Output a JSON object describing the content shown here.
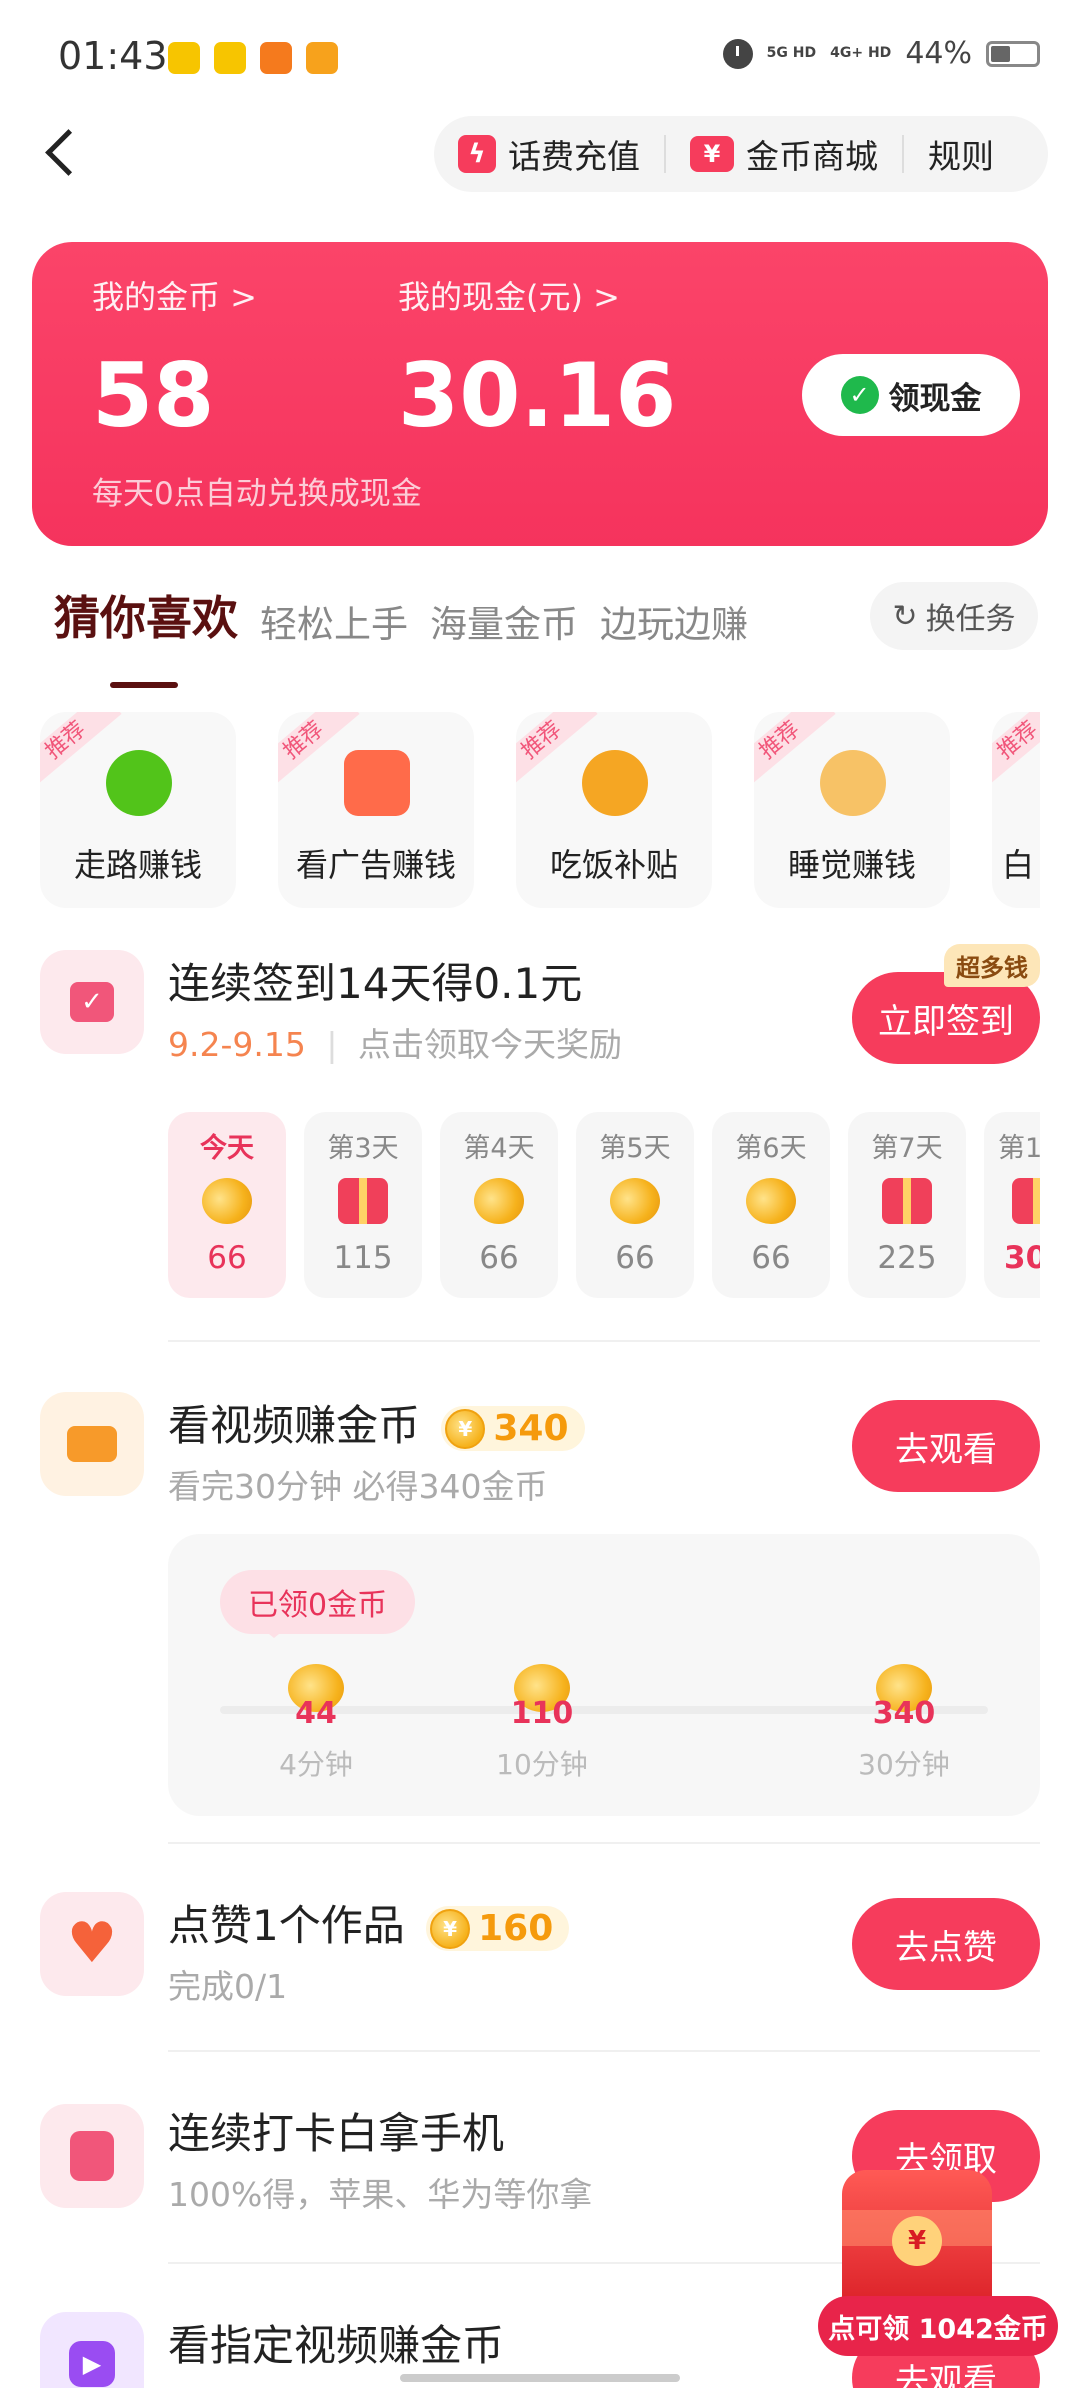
{
  "status_bar": {
    "time": "01:43",
    "signal1": "5G HD",
    "signal2": "4G+ HD",
    "battery": "44%",
    "battery_level": 0.44,
    "app_colors": [
      "#f7c500",
      "#f7c500",
      "#f57a1d",
      "#f7a21c"
    ]
  },
  "header": {
    "recharge_label": "话费充值",
    "mall_label": "金币商城",
    "rules_label": "规则",
    "mall_icon_glyph": "¥",
    "recharge_icon_glyph": "ϟ"
  },
  "balance": {
    "coins_label": "我的金币 >",
    "coins_value": "58",
    "cash_label": "我的现金(元) >",
    "cash_value": "30.16",
    "claim_cash_label": "领现金",
    "note": "每天0点自动兑换成现金",
    "card_color": "#f5335d"
  },
  "tabs": {
    "items": [
      "猜你喜欢",
      "轻松上手",
      "海量金币",
      "边玩边赚"
    ],
    "active": "猜你喜欢",
    "swap_label": "换任务"
  },
  "tiles": {
    "recommend_tag": "推荐",
    "items": [
      {
        "label": "走路赚钱",
        "icon": "walking-figure-icon",
        "color": "#52c41a"
      },
      {
        "label": "看广告赚钱",
        "icon": "tv-ad-icon",
        "color": "#ff6b4a"
      },
      {
        "label": "吃饭补贴",
        "icon": "noodle-bowl-icon",
        "color": "#f5a623"
      },
      {
        "label": "睡觉赚钱",
        "icon": "sleeping-person-icon",
        "color": "#f7c266"
      },
      {
        "label": "白",
        "icon": "partial-icon",
        "color": "#ddd"
      }
    ]
  },
  "signin": {
    "title": "连续签到14天得0.1元",
    "date_range": "9.2-9.15",
    "hint": "点击领取今天奖励",
    "badge": "超多钱",
    "button_label": "立即签到",
    "days": [
      {
        "label": "今天",
        "value": "66",
        "reward": "coins"
      },
      {
        "label": "第3天",
        "value": "115",
        "reward": "gift"
      },
      {
        "label": "第4天",
        "value": "66",
        "reward": "coins"
      },
      {
        "label": "第5天",
        "value": "66",
        "reward": "coins"
      },
      {
        "label": "第6天",
        "value": "66",
        "reward": "coins"
      },
      {
        "label": "第7天",
        "value": "225",
        "reward": "gift"
      },
      {
        "label": "第1",
        "value": "30",
        "reward": "gift"
      }
    ]
  },
  "video_task": {
    "title": "看视频赚金币",
    "coins": "340",
    "subtitle": "看完30分钟 必得340金币",
    "button_label": "去观看",
    "claimed_bubble": "已领0金币",
    "milestones": [
      {
        "coins": "44",
        "time": "4分钟"
      },
      {
        "coins": "110",
        "time": "10分钟"
      },
      {
        "coins": "340",
        "time": "30分钟"
      }
    ],
    "progress": 0
  },
  "like_task": {
    "title": "点赞1个作品",
    "coins": "160",
    "subtitle": "完成0/1",
    "button_label": "去点赞"
  },
  "phone_task": {
    "title": "连续打卡白拿手机",
    "subtitle": "100%得，苹果、华为等你拿",
    "button_label": "去领取"
  },
  "specified_video_task": {
    "title": "看指定视频赚金币",
    "button_label": "去观看"
  },
  "floating_packet": {
    "label": "点可领 1042金币"
  }
}
